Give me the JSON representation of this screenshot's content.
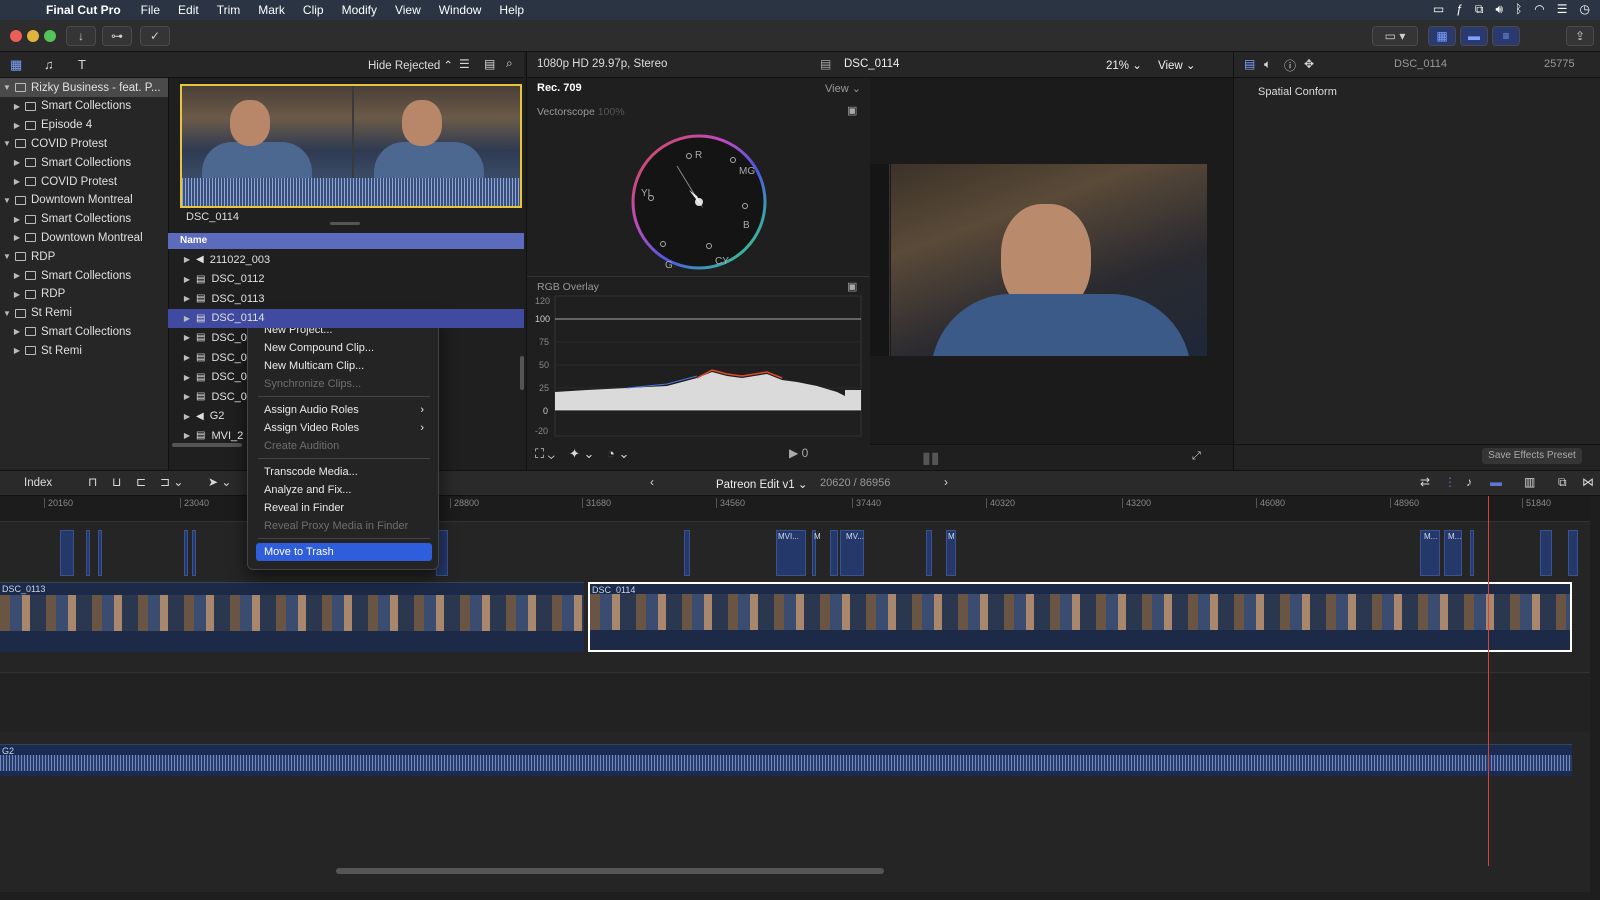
{
  "menubar": {
    "app": "Final Cut Pro",
    "items": [
      "File",
      "Edit",
      "Trim",
      "Mark",
      "Clip",
      "Modify",
      "View",
      "Window",
      "Help"
    ]
  },
  "library": {
    "rows": [
      {
        "label": "Rizky Business - feat. P...",
        "level": 0,
        "selected": true,
        "icon": "library-icon"
      },
      {
        "label": "Smart Collections",
        "level": 1,
        "icon": "folder-icon"
      },
      {
        "label": "Episode 4",
        "level": 1,
        "icon": "event-icon"
      },
      {
        "label": "COVID Protest",
        "level": 0,
        "icon": "library-icon"
      },
      {
        "label": "Smart Collections",
        "level": 1,
        "icon": "folder-icon"
      },
      {
        "label": "COVID Protest",
        "level": 1,
        "icon": "event-icon"
      },
      {
        "label": "Downtown Montreal",
        "level": 0,
        "icon": "library-icon"
      },
      {
        "label": "Smart Collections",
        "level": 1,
        "icon": "folder-icon"
      },
      {
        "label": "Downtown Montreal",
        "level": 1,
        "icon": "event-icon"
      },
      {
        "label": "RDP",
        "level": 0,
        "icon": "library-icon"
      },
      {
        "label": "Smart Collections",
        "level": 1,
        "icon": "folder-icon"
      },
      {
        "label": "RDP",
        "level": 1,
        "icon": "event-icon"
      },
      {
        "label": "St Remi",
        "level": 0,
        "icon": "library-icon"
      },
      {
        "label": "Smart Collections",
        "level": 1,
        "icon": "folder-icon"
      },
      {
        "label": "St Remi",
        "level": 1,
        "icon": "event-icon"
      }
    ]
  },
  "browser": {
    "filter": "Hide Rejected",
    "clip_title": "DSC_0114",
    "column_name": "Name",
    "rows": [
      {
        "label": "211022_003",
        "icon": "audio-icon"
      },
      {
        "label": "DSC_0112",
        "icon": "film-icon"
      },
      {
        "label": "DSC_0113",
        "icon": "film-icon"
      },
      {
        "label": "DSC_0114",
        "icon": "film-icon",
        "selected": true
      },
      {
        "label": "DSC_0",
        "icon": "film-icon"
      },
      {
        "label": "DSC_0",
        "icon": "film-icon"
      },
      {
        "label": "DSC_0",
        "icon": "film-icon"
      },
      {
        "label": "DSC_0",
        "icon": "film-icon"
      },
      {
        "label": "G2",
        "icon": "audio-icon"
      },
      {
        "label": "MVI_2",
        "icon": "film-icon"
      }
    ]
  },
  "context_menu": {
    "items": [
      {
        "label": "New Project...",
        "enabled": true
      },
      {
        "label": "New Compound Clip...",
        "enabled": true
      },
      {
        "label": "New Multicam Clip...",
        "enabled": true
      },
      {
        "label": "Synchronize Clips...",
        "enabled": false
      },
      {
        "sep": true
      },
      {
        "label": "Assign Audio Roles",
        "enabled": true,
        "submenu": true
      },
      {
        "label": "Assign Video Roles",
        "enabled": true,
        "submenu": true
      },
      {
        "label": "Create Audition",
        "enabled": false
      },
      {
        "sep": true
      },
      {
        "label": "Transcode Media...",
        "enabled": true
      },
      {
        "label": "Analyze and Fix...",
        "enabled": true
      },
      {
        "label": "Reveal in Finder",
        "enabled": true
      },
      {
        "label": "Reveal Proxy Media in Finder",
        "enabled": false
      },
      {
        "sep": true
      },
      {
        "label": "Move to Trash",
        "enabled": true,
        "highlighted": true
      }
    ]
  },
  "viewer": {
    "format": "1080p HD 29.97p, Stereo",
    "clip": "DSC_0114",
    "zoom": "21%",
    "view_label": "View",
    "color_space": "Rec. 709",
    "scope_view": "View",
    "vectorscope_label": "Vectorscope",
    "vectorscope_pct": "100%",
    "rgb_label": "RGB Overlay",
    "y_ticks": [
      "120",
      "100",
      "75",
      "50",
      "25",
      "0",
      "-20"
    ],
    "vector_targets": [
      "R",
      "MG",
      "B",
      "CY",
      "G",
      "YL"
    ]
  },
  "inspector": {
    "clip": "DSC_0114",
    "frames": "25775",
    "section": "Spatial Conform",
    "save_preset": "Save Effects Preset"
  },
  "timeline": {
    "index_label": "Index",
    "project": "Patreon Edit v1",
    "position": "20620 / 86956",
    "ruler": [
      "20160",
      "23040",
      "28800",
      "31680",
      "34560",
      "37440",
      "40320",
      "43200",
      "46080",
      "48960",
      "51840"
    ],
    "clips": {
      "primary_a": "DSC_0113",
      "primary_b": "DSC_0114",
      "audio": "G2",
      "connected": [
        "MVI...",
        "M",
        "MV...",
        "M",
        "M...",
        "M..."
      ]
    }
  },
  "colors": {
    "selection_blue": "#3f4aa0",
    "menu_highlight": "#2e5edb",
    "playhead": "#d9423a",
    "filmstrip_border": "#e6c53c"
  }
}
